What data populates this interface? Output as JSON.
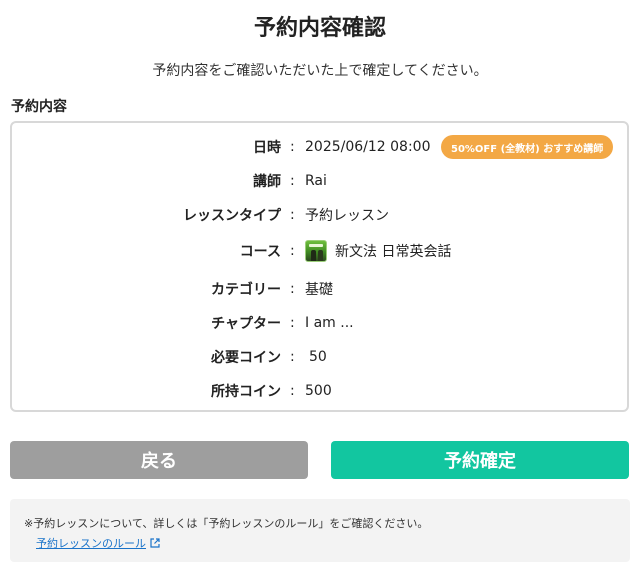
{
  "page": {
    "title": "予約内容確認",
    "subtitle": "予約内容をご確認いただいた上で確定してください。",
    "section_label": "予約内容"
  },
  "details": {
    "datetime": {
      "label": "日時",
      "colon": ":",
      "value": "2025/06/12 08:00",
      "badge": "50%OFF (全教材) おすすめ講師"
    },
    "teacher": {
      "label": "講師",
      "colon": ":",
      "value": "Rai"
    },
    "lesson_type": {
      "label": "レッスンタイプ",
      "colon": ":",
      "value": "予約レッスン"
    },
    "course": {
      "label": "コース",
      "colon": ":",
      "value": "新文法 日常英会話",
      "icon": "course-thumbnail-icon"
    },
    "category": {
      "label": "カテゴリー",
      "colon": ":",
      "value": "基礎"
    },
    "chapter": {
      "label": "チャプター",
      "colon": ":",
      "value": "I am ..."
    },
    "required_coins": {
      "label": "必要コイン",
      "colon": ":",
      "value": "50"
    },
    "owned_coins": {
      "label": "所持コイン",
      "colon": ":",
      "value": "500"
    }
  },
  "buttons": {
    "back": "戻る",
    "confirm": "予約確定"
  },
  "note": {
    "text": "※予約レッスンについて、詳しくは「予約レッスンのルール」をご確認ください。",
    "link": "予約レッスンのルール",
    "link_icon": "external-link-icon"
  },
  "colors": {
    "badge": "#f3a845",
    "confirm_button": "#12c6a0",
    "back_button": "#9e9e9e",
    "link": "#1a73c9"
  }
}
